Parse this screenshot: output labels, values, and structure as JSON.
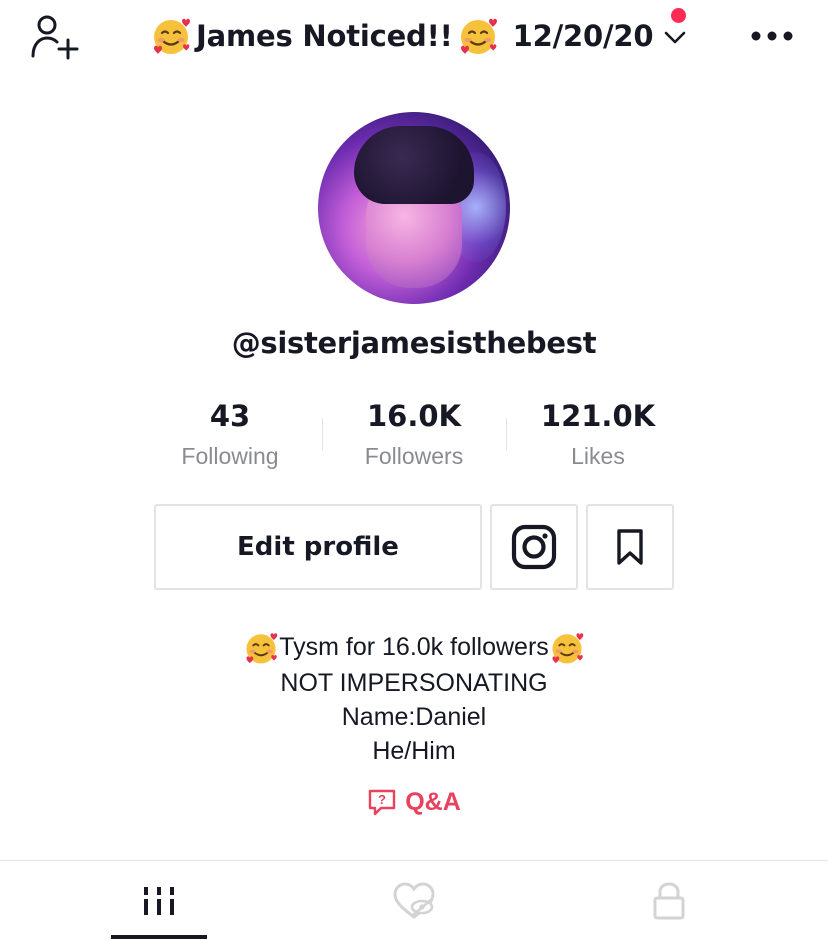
{
  "header": {
    "title": "James Noticed!!",
    "date": "12/20/20",
    "title_emoji": "smiling-face-with-hearts",
    "notification_dot_color": "#fe2c55",
    "add_user_icon": "person-add-icon",
    "more_icon": "ellipsis-icon"
  },
  "profile": {
    "username": "@sisterjamesisthebest",
    "avatar": "profile-photo"
  },
  "stats": [
    {
      "value": "43",
      "label": "Following"
    },
    {
      "value": "16.0K",
      "label": "Followers"
    },
    {
      "value": "121.0K",
      "label": "Likes"
    }
  ],
  "actions": {
    "edit_profile": "Edit profile",
    "instagram_icon": "instagram-icon",
    "bookmark_icon": "bookmark-icon"
  },
  "bio": {
    "line1": "Tysm for 16.0k followers",
    "line2": "NOT IMPERSONATING",
    "line3": "Name:Daniel",
    "line4": "He/Him"
  },
  "qa": {
    "label": "Q&A",
    "color": "#e8425e",
    "icon": "question-bubble-icon"
  },
  "tabs": [
    {
      "name": "videos",
      "icon": "grid-bars-icon",
      "active": true
    },
    {
      "name": "liked",
      "icon": "heart-hidden-icon",
      "active": false
    },
    {
      "name": "private",
      "icon": "lock-icon",
      "active": false
    }
  ]
}
